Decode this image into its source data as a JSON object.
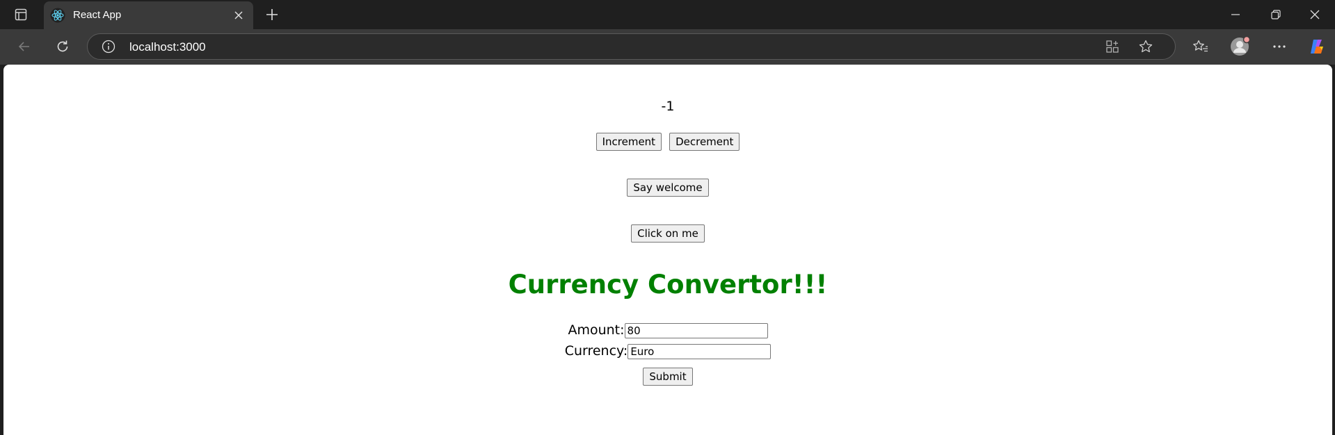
{
  "browser": {
    "tab_title": "React App",
    "url": "localhost:3000",
    "icons": {
      "tab_actions": "tab-actions-icon",
      "favicon": "react-logo-icon",
      "tab_close": "close-icon",
      "new_tab": "plus-icon",
      "minimize": "minimize-icon",
      "restore": "restore-icon",
      "close": "close-icon",
      "back": "back-arrow-icon",
      "reload": "reload-icon",
      "site_info": "info-icon",
      "app_available": "app-available-icon",
      "add_favorite": "star-icon",
      "favorites": "favorites-icon",
      "profile": "profile-icon",
      "more": "more-icon",
      "copilot": "copilot-icon"
    }
  },
  "page": {
    "count": "-1",
    "increment_label": "Increment",
    "decrement_label": "Decrement",
    "welcome_label": "Say welcome",
    "click_label": "Click on me",
    "heading": "Currency Convertor!!!",
    "heading_color": "#008000",
    "amount_label": "Amount:",
    "amount_value": "80",
    "currency_label": "Currency:",
    "currency_value": "Euro",
    "submit_label": "Submit"
  }
}
